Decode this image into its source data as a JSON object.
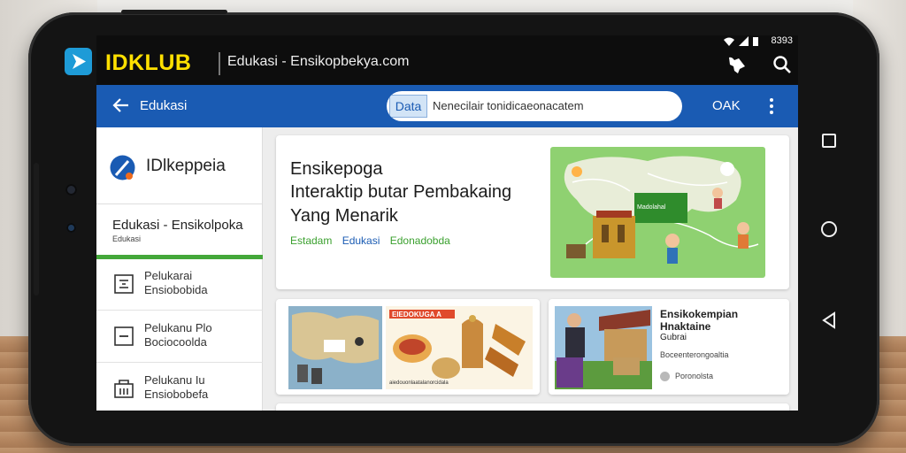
{
  "status": {
    "time": "8393"
  },
  "app": {
    "brand": "IDKLUB",
    "site_title": "Edukasi - Ensikopbekya.com",
    "icons": [
      "play-logo-icon",
      "announce-icon",
      "search-icon"
    ]
  },
  "nav": {
    "back_label": "Edukasi",
    "search": {
      "tag": "Data",
      "text": "Nenecilair tonidicaeonacatem"
    },
    "action_label": "OAK"
  },
  "sidebar": {
    "brand": "IDlkeppeia",
    "title": "Edukasi - Ensikolpoka",
    "subtitle": "Edukasi",
    "items": [
      {
        "line1": "Pelukarai",
        "line2": "Ensiobobida",
        "icon": "list-icon"
      },
      {
        "line1": "Pelukanu Plo",
        "line2": "Bociocoolda",
        "icon": "minus-box-icon"
      },
      {
        "line1": "Pelukanu Iu",
        "line2": "Ensiobobefa",
        "icon": "building-icon"
      }
    ]
  },
  "hero": {
    "line1": "Ensikepoga",
    "line2": "Interaktip butar Pembakaing",
    "line3": "Yang Menarik",
    "tags": [
      "Estadam",
      "Edukasi",
      "Edonadobda"
    ],
    "map_label": "Madolahal"
  },
  "cards": {
    "food_banner": "EIEDOKUGA A",
    "food_caption": "aiedouonlaatalanorcidala",
    "article": {
      "title1": "Ensikokempian",
      "title2": "Hnaktaine",
      "title3": "Gubrai",
      "subtitle": "Boceenterongoaltia",
      "meta": "Poronolsta"
    }
  },
  "colors": {
    "appbar": "#0d0d0d",
    "brand_yellow": "#ffe000",
    "navbar_blue": "#1a5bb3",
    "accent_green": "#44a83a",
    "tag_green": "#3aa02e"
  }
}
